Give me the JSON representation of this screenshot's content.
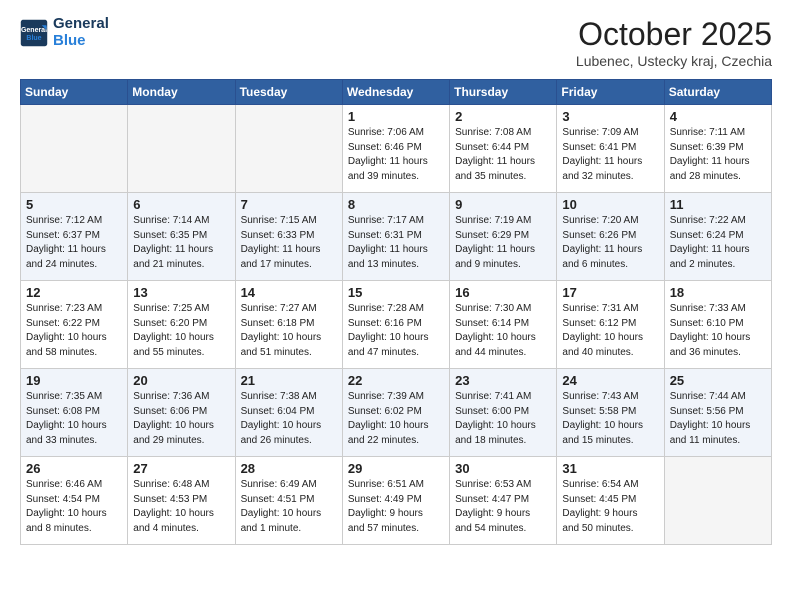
{
  "header": {
    "logo_line1": "General",
    "logo_line2": "Blue",
    "month": "October 2025",
    "location": "Lubenec, Ustecky kraj, Czechia"
  },
  "weekdays": [
    "Sunday",
    "Monday",
    "Tuesday",
    "Wednesday",
    "Thursday",
    "Friday",
    "Saturday"
  ],
  "weeks": [
    [
      {
        "day": "",
        "info": ""
      },
      {
        "day": "",
        "info": ""
      },
      {
        "day": "",
        "info": ""
      },
      {
        "day": "1",
        "info": "Sunrise: 7:06 AM\nSunset: 6:46 PM\nDaylight: 11 hours\nand 39 minutes."
      },
      {
        "day": "2",
        "info": "Sunrise: 7:08 AM\nSunset: 6:44 PM\nDaylight: 11 hours\nand 35 minutes."
      },
      {
        "day": "3",
        "info": "Sunrise: 7:09 AM\nSunset: 6:41 PM\nDaylight: 11 hours\nand 32 minutes."
      },
      {
        "day": "4",
        "info": "Sunrise: 7:11 AM\nSunset: 6:39 PM\nDaylight: 11 hours\nand 28 minutes."
      }
    ],
    [
      {
        "day": "5",
        "info": "Sunrise: 7:12 AM\nSunset: 6:37 PM\nDaylight: 11 hours\nand 24 minutes."
      },
      {
        "day": "6",
        "info": "Sunrise: 7:14 AM\nSunset: 6:35 PM\nDaylight: 11 hours\nand 21 minutes."
      },
      {
        "day": "7",
        "info": "Sunrise: 7:15 AM\nSunset: 6:33 PM\nDaylight: 11 hours\nand 17 minutes."
      },
      {
        "day": "8",
        "info": "Sunrise: 7:17 AM\nSunset: 6:31 PM\nDaylight: 11 hours\nand 13 minutes."
      },
      {
        "day": "9",
        "info": "Sunrise: 7:19 AM\nSunset: 6:29 PM\nDaylight: 11 hours\nand 9 minutes."
      },
      {
        "day": "10",
        "info": "Sunrise: 7:20 AM\nSunset: 6:26 PM\nDaylight: 11 hours\nand 6 minutes."
      },
      {
        "day": "11",
        "info": "Sunrise: 7:22 AM\nSunset: 6:24 PM\nDaylight: 11 hours\nand 2 minutes."
      }
    ],
    [
      {
        "day": "12",
        "info": "Sunrise: 7:23 AM\nSunset: 6:22 PM\nDaylight: 10 hours\nand 58 minutes."
      },
      {
        "day": "13",
        "info": "Sunrise: 7:25 AM\nSunset: 6:20 PM\nDaylight: 10 hours\nand 55 minutes."
      },
      {
        "day": "14",
        "info": "Sunrise: 7:27 AM\nSunset: 6:18 PM\nDaylight: 10 hours\nand 51 minutes."
      },
      {
        "day": "15",
        "info": "Sunrise: 7:28 AM\nSunset: 6:16 PM\nDaylight: 10 hours\nand 47 minutes."
      },
      {
        "day": "16",
        "info": "Sunrise: 7:30 AM\nSunset: 6:14 PM\nDaylight: 10 hours\nand 44 minutes."
      },
      {
        "day": "17",
        "info": "Sunrise: 7:31 AM\nSunset: 6:12 PM\nDaylight: 10 hours\nand 40 minutes."
      },
      {
        "day": "18",
        "info": "Sunrise: 7:33 AM\nSunset: 6:10 PM\nDaylight: 10 hours\nand 36 minutes."
      }
    ],
    [
      {
        "day": "19",
        "info": "Sunrise: 7:35 AM\nSunset: 6:08 PM\nDaylight: 10 hours\nand 33 minutes."
      },
      {
        "day": "20",
        "info": "Sunrise: 7:36 AM\nSunset: 6:06 PM\nDaylight: 10 hours\nand 29 minutes."
      },
      {
        "day": "21",
        "info": "Sunrise: 7:38 AM\nSunset: 6:04 PM\nDaylight: 10 hours\nand 26 minutes."
      },
      {
        "day": "22",
        "info": "Sunrise: 7:39 AM\nSunset: 6:02 PM\nDaylight: 10 hours\nand 22 minutes."
      },
      {
        "day": "23",
        "info": "Sunrise: 7:41 AM\nSunset: 6:00 PM\nDaylight: 10 hours\nand 18 minutes."
      },
      {
        "day": "24",
        "info": "Sunrise: 7:43 AM\nSunset: 5:58 PM\nDaylight: 10 hours\nand 15 minutes."
      },
      {
        "day": "25",
        "info": "Sunrise: 7:44 AM\nSunset: 5:56 PM\nDaylight: 10 hours\nand 11 minutes."
      }
    ],
    [
      {
        "day": "26",
        "info": "Sunrise: 6:46 AM\nSunset: 4:54 PM\nDaylight: 10 hours\nand 8 minutes."
      },
      {
        "day": "27",
        "info": "Sunrise: 6:48 AM\nSunset: 4:53 PM\nDaylight: 10 hours\nand 4 minutes."
      },
      {
        "day": "28",
        "info": "Sunrise: 6:49 AM\nSunset: 4:51 PM\nDaylight: 10 hours\nand 1 minute."
      },
      {
        "day": "29",
        "info": "Sunrise: 6:51 AM\nSunset: 4:49 PM\nDaylight: 9 hours\nand 57 minutes."
      },
      {
        "day": "30",
        "info": "Sunrise: 6:53 AM\nSunset: 4:47 PM\nDaylight: 9 hours\nand 54 minutes."
      },
      {
        "day": "31",
        "info": "Sunrise: 6:54 AM\nSunset: 4:45 PM\nDaylight: 9 hours\nand 50 minutes."
      },
      {
        "day": "",
        "info": ""
      }
    ]
  ]
}
